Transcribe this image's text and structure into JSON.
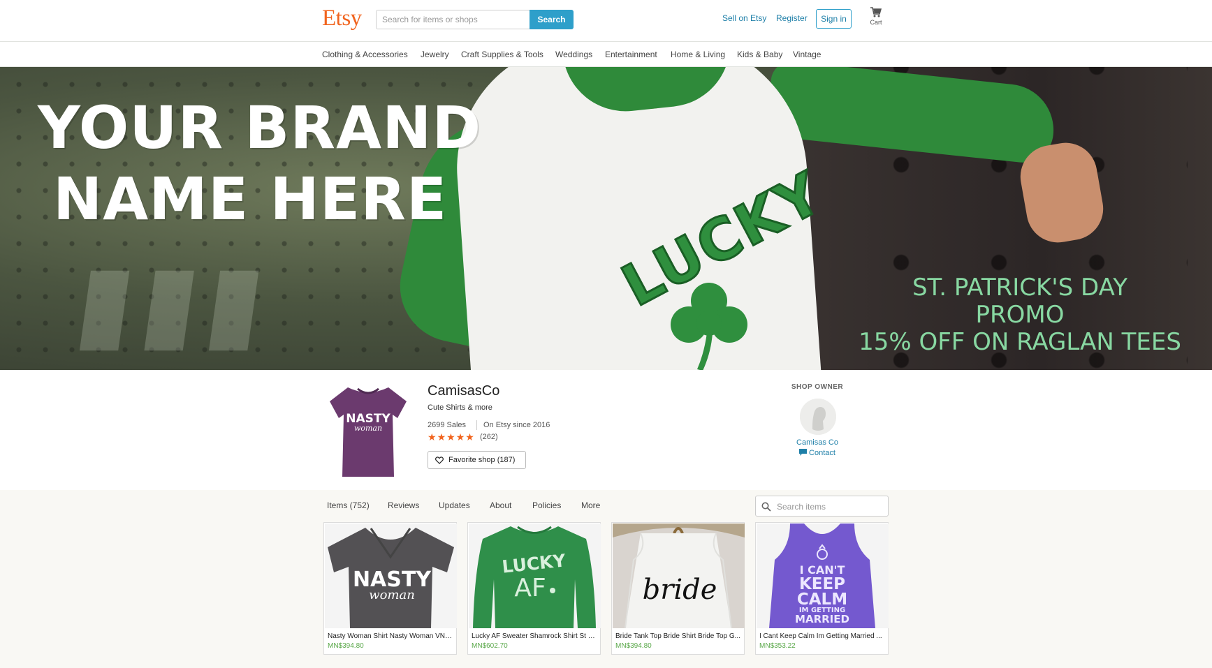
{
  "header": {
    "logo": "Etsy",
    "search_placeholder": "Search for items or shops",
    "search_button": "Search",
    "sell_link": "Sell on Etsy",
    "register_link": "Register",
    "signin_button": "Sign in",
    "cart_label": "Cart"
  },
  "categories": [
    "Clothing & Accessories",
    "Jewelry",
    "Craft Supplies & Tools",
    "Weddings",
    "Entertainment",
    "Home & Living",
    "Kids & Baby",
    "Vintage"
  ],
  "banner": {
    "brand_line_1": "YOUR BRAND",
    "brand_line_2": "NAME HERE",
    "shirt_text": "LUCKY",
    "promo_line_1": "ST. PATRICK'S DAY",
    "promo_line_2": "PROMO",
    "promo_line_3": "15% OFF ON RAGLAN TEES"
  },
  "shop": {
    "name": "CamisasCo",
    "tagline": "Cute Shirts & more",
    "sales": "2699 Sales",
    "since": "On Etsy since 2016",
    "rating_stars": 5,
    "review_count": "(262)",
    "favorite_button": "Favorite shop (187)",
    "icon_text_1": "NASTY",
    "icon_text_2": "woman"
  },
  "owner": {
    "title": "SHOP OWNER",
    "name": "Camisas Co",
    "contact": "Contact"
  },
  "tabs": [
    "Items (752)",
    "Reviews",
    "Updates",
    "About",
    "Policies",
    "More"
  ],
  "item_search_placeholder": "Search items",
  "items": [
    {
      "title": "Nasty Woman Shirt Nasty Woman VNe...",
      "price": "MN$394.80",
      "print_1": "NASTY",
      "print_2": "woman"
    },
    {
      "title": "Lucky AF Sweater Shamrock Shirt St P...",
      "price": "MN$602.70",
      "print_1": "LUCKY",
      "print_2": "AF"
    },
    {
      "title": "Bride Tank Top Bride Shirt Bride Top G...",
      "price": "MN$394.80",
      "print_1": "bride"
    },
    {
      "title": "I Cant Keep Calm Im Getting Married ...",
      "price": "MN$353.22",
      "print_1": "I CAN'T",
      "print_2": "KEEP",
      "print_3": "CALM",
      "print_4": "IM GETTING",
      "print_5": "MARRIED"
    }
  ],
  "colors": {
    "etsy_orange": "#f1641e",
    "link_blue": "#1e7fa8",
    "search_blue": "#2e9fca",
    "price_green": "#5aa84a",
    "promo_green": "#88d8a2"
  }
}
